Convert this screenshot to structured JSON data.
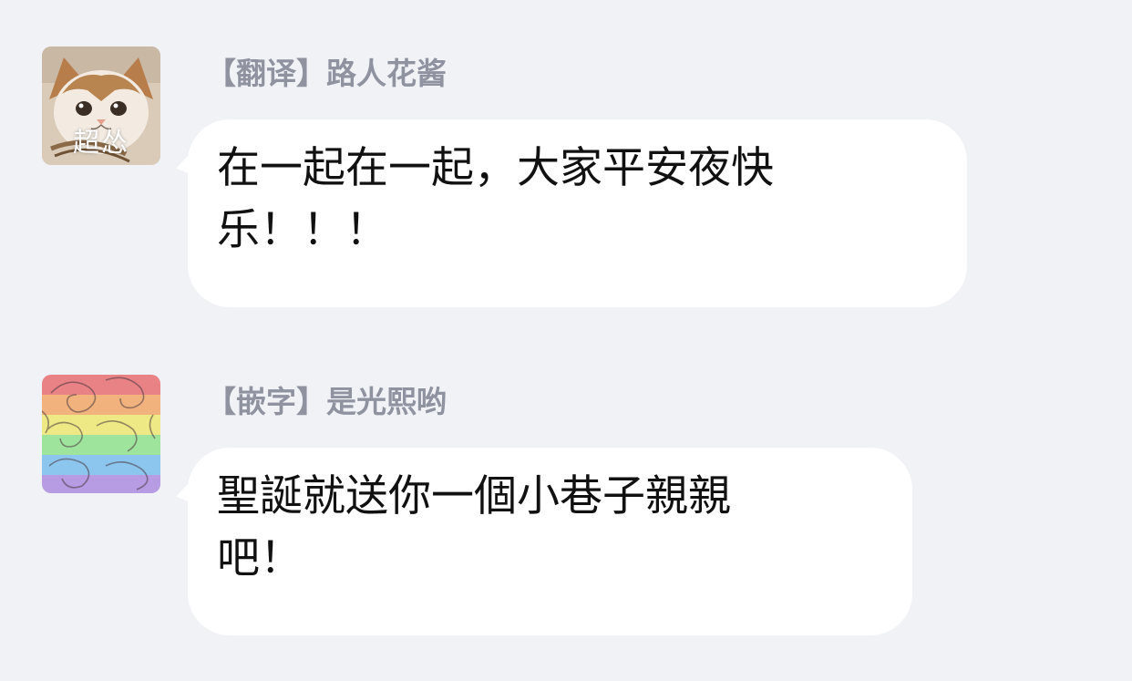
{
  "messages": [
    {
      "sender": "【翻译】路人花酱",
      "avatar_label": "超怂",
      "avatar_icon": "cat-photo",
      "lines": [
        "在一起在一起，大家平安夜快",
        "乐！！！"
      ]
    },
    {
      "sender": "【嵌字】是光熙哟",
      "avatar_icon": "rainbow-flower-pattern",
      "lines": [
        "聖誕就送你一個小巷子親親",
        "吧！"
      ]
    }
  ]
}
